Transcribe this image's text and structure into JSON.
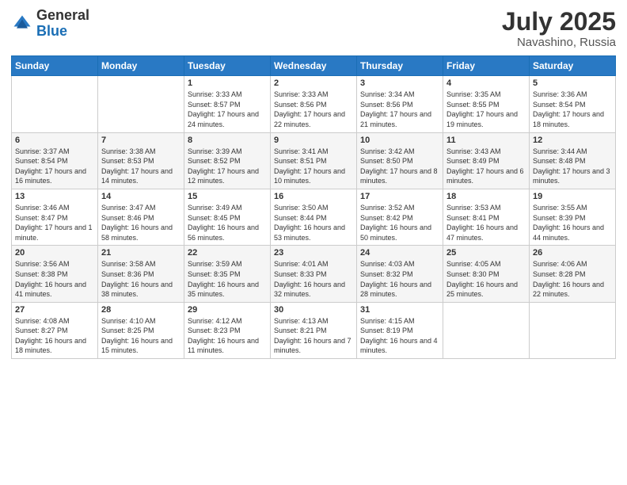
{
  "header": {
    "logo_general": "General",
    "logo_blue": "Blue",
    "month_year": "July 2025",
    "location": "Navashino, Russia"
  },
  "weekdays": [
    "Sunday",
    "Monday",
    "Tuesday",
    "Wednesday",
    "Thursday",
    "Friday",
    "Saturday"
  ],
  "weeks": [
    [
      {
        "day": "",
        "info": ""
      },
      {
        "day": "",
        "info": ""
      },
      {
        "day": "1",
        "info": "Sunrise: 3:33 AM\nSunset: 8:57 PM\nDaylight: 17 hours and 24 minutes."
      },
      {
        "day": "2",
        "info": "Sunrise: 3:33 AM\nSunset: 8:56 PM\nDaylight: 17 hours and 22 minutes."
      },
      {
        "day": "3",
        "info": "Sunrise: 3:34 AM\nSunset: 8:56 PM\nDaylight: 17 hours and 21 minutes."
      },
      {
        "day": "4",
        "info": "Sunrise: 3:35 AM\nSunset: 8:55 PM\nDaylight: 17 hours and 19 minutes."
      },
      {
        "day": "5",
        "info": "Sunrise: 3:36 AM\nSunset: 8:54 PM\nDaylight: 17 hours and 18 minutes."
      }
    ],
    [
      {
        "day": "6",
        "info": "Sunrise: 3:37 AM\nSunset: 8:54 PM\nDaylight: 17 hours and 16 minutes."
      },
      {
        "day": "7",
        "info": "Sunrise: 3:38 AM\nSunset: 8:53 PM\nDaylight: 17 hours and 14 minutes."
      },
      {
        "day": "8",
        "info": "Sunrise: 3:39 AM\nSunset: 8:52 PM\nDaylight: 17 hours and 12 minutes."
      },
      {
        "day": "9",
        "info": "Sunrise: 3:41 AM\nSunset: 8:51 PM\nDaylight: 17 hours and 10 minutes."
      },
      {
        "day": "10",
        "info": "Sunrise: 3:42 AM\nSunset: 8:50 PM\nDaylight: 17 hours and 8 minutes."
      },
      {
        "day": "11",
        "info": "Sunrise: 3:43 AM\nSunset: 8:49 PM\nDaylight: 17 hours and 6 minutes."
      },
      {
        "day": "12",
        "info": "Sunrise: 3:44 AM\nSunset: 8:48 PM\nDaylight: 17 hours and 3 minutes."
      }
    ],
    [
      {
        "day": "13",
        "info": "Sunrise: 3:46 AM\nSunset: 8:47 PM\nDaylight: 17 hours and 1 minute."
      },
      {
        "day": "14",
        "info": "Sunrise: 3:47 AM\nSunset: 8:46 PM\nDaylight: 16 hours and 58 minutes."
      },
      {
        "day": "15",
        "info": "Sunrise: 3:49 AM\nSunset: 8:45 PM\nDaylight: 16 hours and 56 minutes."
      },
      {
        "day": "16",
        "info": "Sunrise: 3:50 AM\nSunset: 8:44 PM\nDaylight: 16 hours and 53 minutes."
      },
      {
        "day": "17",
        "info": "Sunrise: 3:52 AM\nSunset: 8:42 PM\nDaylight: 16 hours and 50 minutes."
      },
      {
        "day": "18",
        "info": "Sunrise: 3:53 AM\nSunset: 8:41 PM\nDaylight: 16 hours and 47 minutes."
      },
      {
        "day": "19",
        "info": "Sunrise: 3:55 AM\nSunset: 8:39 PM\nDaylight: 16 hours and 44 minutes."
      }
    ],
    [
      {
        "day": "20",
        "info": "Sunrise: 3:56 AM\nSunset: 8:38 PM\nDaylight: 16 hours and 41 minutes."
      },
      {
        "day": "21",
        "info": "Sunrise: 3:58 AM\nSunset: 8:36 PM\nDaylight: 16 hours and 38 minutes."
      },
      {
        "day": "22",
        "info": "Sunrise: 3:59 AM\nSunset: 8:35 PM\nDaylight: 16 hours and 35 minutes."
      },
      {
        "day": "23",
        "info": "Sunrise: 4:01 AM\nSunset: 8:33 PM\nDaylight: 16 hours and 32 minutes."
      },
      {
        "day": "24",
        "info": "Sunrise: 4:03 AM\nSunset: 8:32 PM\nDaylight: 16 hours and 28 minutes."
      },
      {
        "day": "25",
        "info": "Sunrise: 4:05 AM\nSunset: 8:30 PM\nDaylight: 16 hours and 25 minutes."
      },
      {
        "day": "26",
        "info": "Sunrise: 4:06 AM\nSunset: 8:28 PM\nDaylight: 16 hours and 22 minutes."
      }
    ],
    [
      {
        "day": "27",
        "info": "Sunrise: 4:08 AM\nSunset: 8:27 PM\nDaylight: 16 hours and 18 minutes."
      },
      {
        "day": "28",
        "info": "Sunrise: 4:10 AM\nSunset: 8:25 PM\nDaylight: 16 hours and 15 minutes."
      },
      {
        "day": "29",
        "info": "Sunrise: 4:12 AM\nSunset: 8:23 PM\nDaylight: 16 hours and 11 minutes."
      },
      {
        "day": "30",
        "info": "Sunrise: 4:13 AM\nSunset: 8:21 PM\nDaylight: 16 hours and 7 minutes."
      },
      {
        "day": "31",
        "info": "Sunrise: 4:15 AM\nSunset: 8:19 PM\nDaylight: 16 hours and 4 minutes."
      },
      {
        "day": "",
        "info": ""
      },
      {
        "day": "",
        "info": ""
      }
    ]
  ]
}
